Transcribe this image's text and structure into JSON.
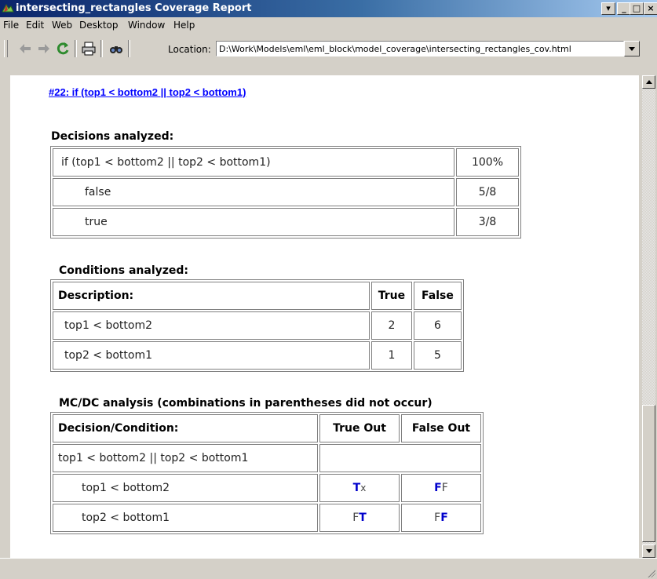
{
  "window": {
    "title": "intersecting_rectangles Coverage Report",
    "controls": {
      "restore": "▾",
      "minimize": "_",
      "maximize": "□",
      "close": "×"
    }
  },
  "menu": [
    "File",
    "Edit",
    "Web",
    "Desktop",
    "Window",
    "Help"
  ],
  "toolbar": {
    "location_label": "Location:",
    "location_value": "D:\\Work\\Models\\eml\\eml_block\\model_coverage\\intersecting_rectangles_cov.html",
    "icons": [
      "back-icon",
      "forward-icon",
      "refresh-icon",
      "print-icon",
      "find-icon"
    ]
  },
  "report": {
    "heading": "#22: if (top1 < bottom2 || top2 < bottom1)",
    "decisions": {
      "title": "Decisions analyzed:",
      "rows": [
        {
          "label": "if (top1 < bottom2 || top2 < bottom1)",
          "value": "100%"
        },
        {
          "label": "false",
          "value": "5/8"
        },
        {
          "label": "true",
          "value": "3/8"
        }
      ]
    },
    "conditions": {
      "title": "Conditions analyzed:",
      "headers": [
        "Description:",
        "True",
        "False"
      ],
      "rows": [
        {
          "description": "top1 < bottom2",
          "true": "2",
          "false": "6"
        },
        {
          "description": "top2 < bottom1",
          "true": "1",
          "false": "5"
        }
      ]
    },
    "mcdc": {
      "title": "MC/DC analysis (combinations in parentheses did not occur)",
      "headers": [
        "Decision/Condition:",
        "True Out",
        "False Out"
      ],
      "decision_row": "top1 < bottom2 || top2 < bottom1",
      "rows": [
        {
          "label": "top1 < bottom2",
          "true_out": [
            "T",
            "x"
          ],
          "false_out": [
            "F",
            "F"
          ]
        },
        {
          "label": "top2 < bottom1",
          "true_out": [
            "F",
            "T"
          ],
          "false_out": [
            "F",
            "F"
          ]
        }
      ]
    }
  },
  "colors": {
    "link": "#0000ff",
    "highlight": "#0000cc",
    "titlebar_start": "#0a246a",
    "titlebar_end": "#a6caf0"
  }
}
